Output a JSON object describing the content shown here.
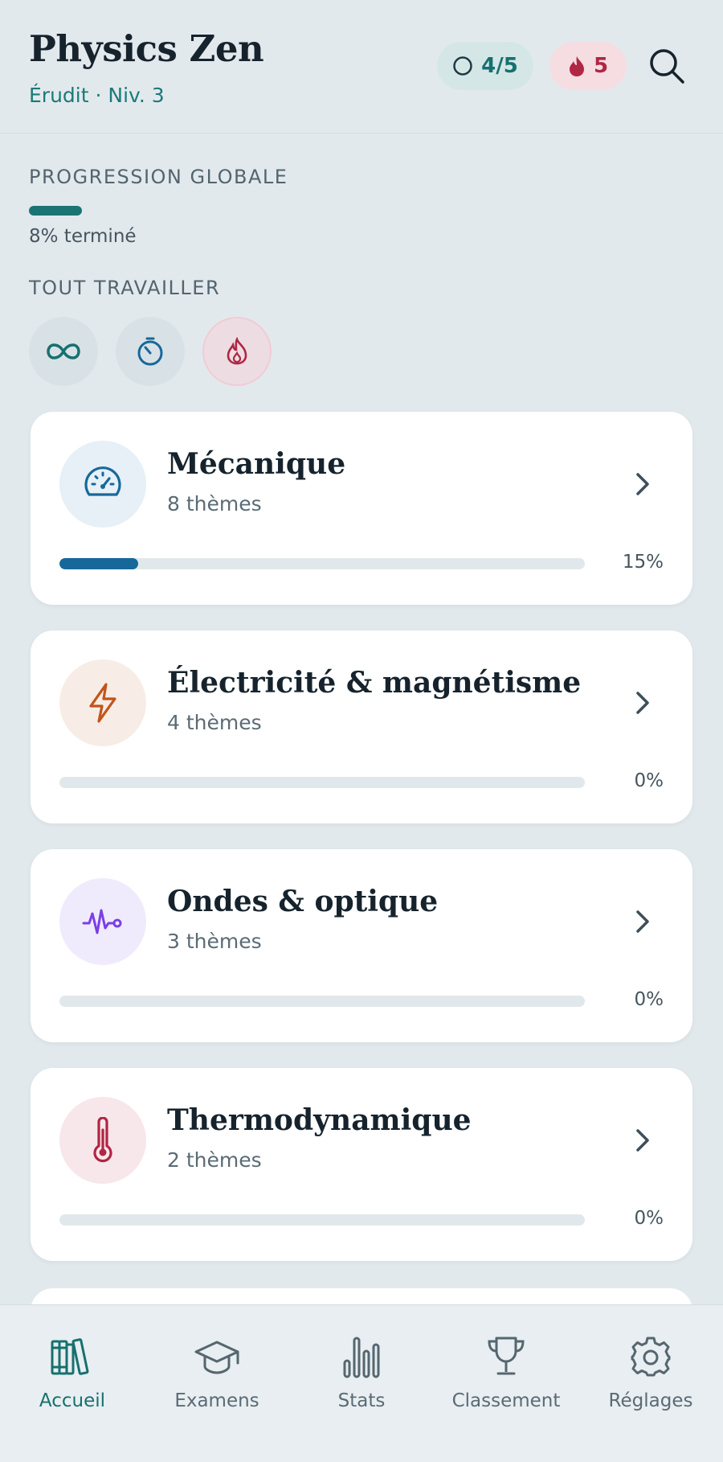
{
  "header": {
    "title": "Physics Zen",
    "subtitle": "Érudit · Niv. 3",
    "lives": "4/5",
    "streak": "5",
    "search_icon": "search-icon"
  },
  "progress": {
    "label": "PROGRESSION GLOBALE",
    "value_percent": 8,
    "text": "8% terminé"
  },
  "practice": {
    "label": "TOUT TRAVAILLER",
    "modes": [
      "infinity-icon",
      "timer-icon",
      "flame-icon"
    ]
  },
  "subjects": [
    {
      "title": "Mécanique",
      "subtitle": "8 thèmes",
      "percent_text": "15%",
      "progress": 15,
      "icon": "gauge-icon",
      "color": "#17689a",
      "icon_bg": "#e6f0f6"
    },
    {
      "title": "Électricité & magnétisme",
      "subtitle": "4 thèmes",
      "percent_text": "0%",
      "progress": 0,
      "icon": "lightning-icon",
      "color": "#c2541b",
      "icon_bg": "#f7ede6"
    },
    {
      "title": "Ondes & optique",
      "subtitle": "3 thèmes",
      "percent_text": "0%",
      "progress": 0,
      "icon": "wave-icon",
      "color": "#7b3fe4",
      "icon_bg": "#f0ebfc"
    },
    {
      "title": "Thermodynamique",
      "subtitle": "2 thèmes",
      "percent_text": "0%",
      "progress": 0,
      "icon": "thermometer-icon",
      "color": "#b02644",
      "icon_bg": "#f7e7ea"
    }
  ],
  "nav": [
    {
      "label": "Accueil",
      "icon": "books-icon",
      "active": true
    },
    {
      "label": "Examens",
      "icon": "graduation-cap-icon",
      "active": false
    },
    {
      "label": "Stats",
      "icon": "bar-chart-icon",
      "active": false
    },
    {
      "label": "Classement",
      "icon": "trophy-icon",
      "active": false
    },
    {
      "label": "Réglages",
      "icon": "gear-icon",
      "active": false
    }
  ],
  "colors": {
    "accent": "#1a7473",
    "streak": "#b02644",
    "background": "#e2e9ed"
  }
}
